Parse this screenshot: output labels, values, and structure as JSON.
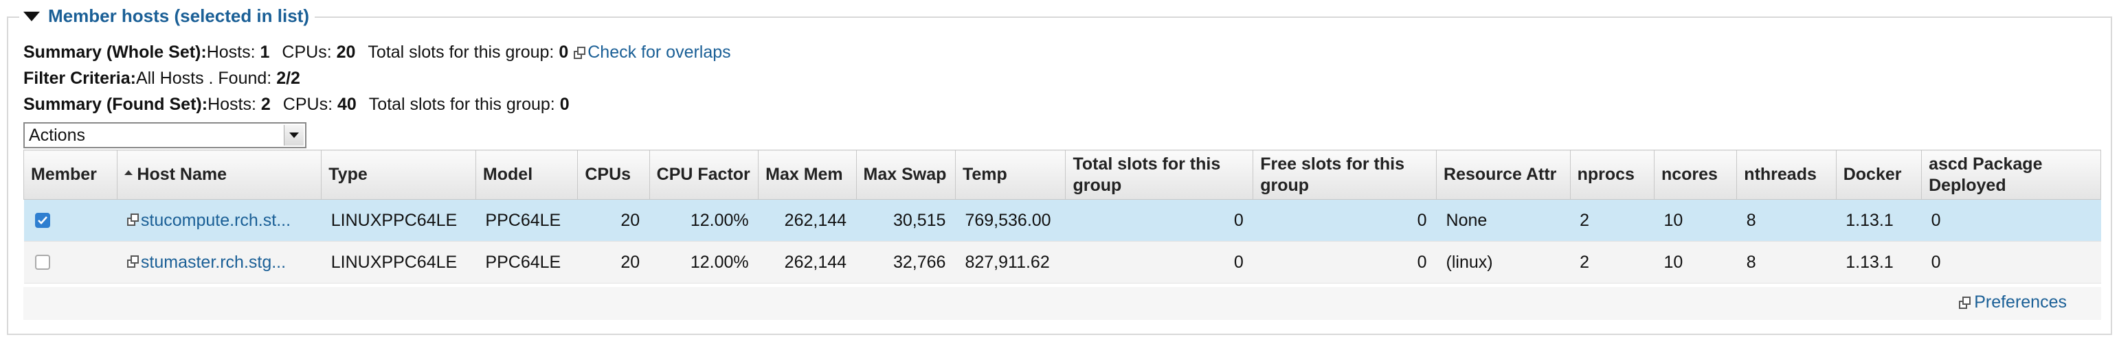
{
  "section": {
    "title": "Member hosts (selected in list)"
  },
  "summary_whole": {
    "label": "Summary (Whole Set):",
    "hosts_label": "Hosts:",
    "hosts": "1",
    "cpus_label": "CPUs:",
    "cpus": "20",
    "slots_label": "Total slots for this group:",
    "slots": "0",
    "overlap_link": "Check for overlaps"
  },
  "filter": {
    "label": "Filter Criteria:",
    "value": "All Hosts . Found:",
    "found": "2/2"
  },
  "summary_found": {
    "label": "Summary (Found Set):",
    "hosts_label": "Hosts:",
    "hosts": "2",
    "cpus_label": "CPUs:",
    "cpus": "40",
    "slots_label": "Total slots for this group:",
    "slots": "0"
  },
  "actions": {
    "selected": "Actions"
  },
  "table": {
    "headers": {
      "member": "Member",
      "host_name": "Host Name",
      "type": "Type",
      "model": "Model",
      "cpus": "CPUs",
      "cpu_factor": "CPU Factor",
      "max_mem": "Max Mem",
      "max_swap": "Max Swap",
      "temp": "Temp",
      "total_slots": "Total slots for this group",
      "free_slots": "Free slots for this group",
      "resource_attr": "Resource Attr",
      "nprocs": "nprocs",
      "ncores": "ncores",
      "nthreads": "nthreads",
      "docker": "Docker",
      "ascd": "ascd Package Deployed"
    },
    "rows": [
      {
        "checked": true,
        "host_name": "stucompute.rch.st...",
        "type": "LINUXPPC64LE",
        "model": "PPC64LE",
        "cpus": "20",
        "cpu_factor": "12.00%",
        "max_mem": "262,144",
        "max_swap": "30,515",
        "temp": "769,536.00",
        "total_slots": "0",
        "free_slots": "0",
        "resource_attr": "None",
        "nprocs": "2",
        "ncores": "10",
        "nthreads": "8",
        "docker": "1.13.1",
        "ascd": "0"
      },
      {
        "checked": false,
        "host_name": "stumaster.rch.stg...",
        "type": "LINUXPPC64LE",
        "model": "PPC64LE",
        "cpus": "20",
        "cpu_factor": "12.00%",
        "max_mem": "262,144",
        "max_swap": "32,766",
        "temp": "827,911.62",
        "total_slots": "0",
        "free_slots": "0",
        "resource_attr": "(linux)",
        "nprocs": "2",
        "ncores": "10",
        "nthreads": "8",
        "docker": "1.13.1",
        "ascd": "0"
      }
    ]
  },
  "footer": {
    "preferences": "Preferences"
  },
  "colors": {
    "link": "#1a5f96",
    "selected_row": "#cde7f5"
  }
}
